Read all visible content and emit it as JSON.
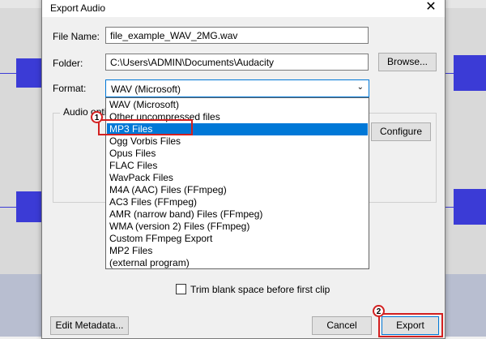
{
  "dialog": {
    "title": "Export Audio",
    "close_glyph": "✕"
  },
  "fields": {
    "file_name_label": "File Name:",
    "file_name_value": "file_example_WAV_2MG.wav",
    "folder_label": "Folder:",
    "folder_value": "C:\\Users\\ADMIN\\Documents\\Audacity",
    "browse_label": "Browse...",
    "format_label": "Format:",
    "format_value": "WAV (Microsoft)"
  },
  "audio_options": {
    "label": "Audio opti",
    "configure_label": "Configure"
  },
  "format_options": [
    "WAV (Microsoft)",
    "Other uncompressed files",
    "MP3 Files",
    "Ogg Vorbis Files",
    "Opus Files",
    "FLAC Files",
    "WavPack Files",
    "M4A (AAC) Files (FFmpeg)",
    "AC3 Files (FFmpeg)",
    "AMR (narrow band) Files (FFmpeg)",
    "WMA (version 2) Files (FFmpeg)",
    "Custom FFmpeg Export",
    "MP2 Files",
    "(external program)"
  ],
  "highlighted_option": "MP3 Files",
  "trim": {
    "label": "Trim blank space before first clip",
    "checked": false
  },
  "footer": {
    "edit_metadata_label": "Edit Metadata...",
    "cancel_label": "Cancel",
    "export_label": "Export"
  },
  "annotations": {
    "step1": "1",
    "step2": "2",
    "color": "#d32020"
  },
  "colors": {
    "selection": "#0078d7",
    "waveform": "#3b3bd6"
  }
}
